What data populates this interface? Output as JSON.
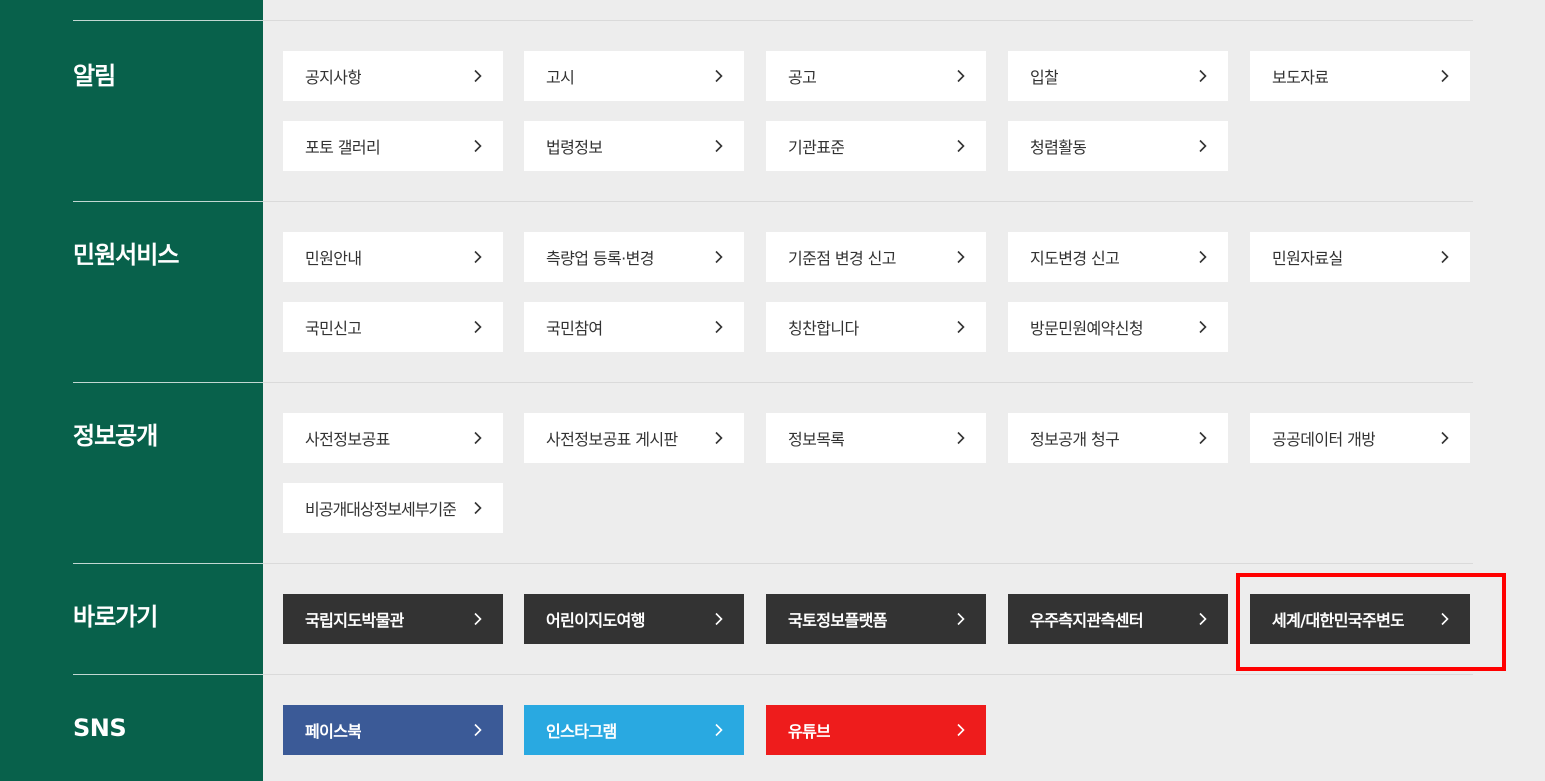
{
  "sections": [
    {
      "title": "알림",
      "items": [
        "공지사항",
        "고시",
        "공고",
        "입찰",
        "보도자료",
        "포토 갤러리",
        "법령정보",
        "기관표준",
        "청렴활동"
      ]
    },
    {
      "title": "민원서비스",
      "items": [
        "민원안내",
        "측량업 등록·변경",
        "기준점 변경 신고",
        "지도변경 신고",
        "민원자료실",
        "국민신고",
        "국민참여",
        "칭찬합니다",
        "방문민원예약신청"
      ]
    },
    {
      "title": "정보공개",
      "items": [
        "사전정보공표",
        "사전정보공표 게시판",
        "정보목록",
        "정보공개 청구",
        "공공데이터 개방",
        "비공개대상정보세부기준"
      ]
    },
    {
      "title": "바로가기",
      "items": [
        "국립지도박물관",
        "어린이지도여행",
        "국토정보플랫폼",
        "우주측지관측센터",
        "세계/대한민국주변도"
      ]
    },
    {
      "title": "SNS",
      "items": [
        "페이스북",
        "인스타그램",
        "유튜브"
      ]
    }
  ],
  "colors": {
    "side_green": "#08614b",
    "page_bg": "#ededed",
    "shortcut_dark": "#333333",
    "facebook": "#3b5a97",
    "instagram": "#29a9e1",
    "youtube": "#ee1c1c",
    "highlight": "#ff0000"
  },
  "icons": {
    "chevron": "chevron-right-icon"
  }
}
